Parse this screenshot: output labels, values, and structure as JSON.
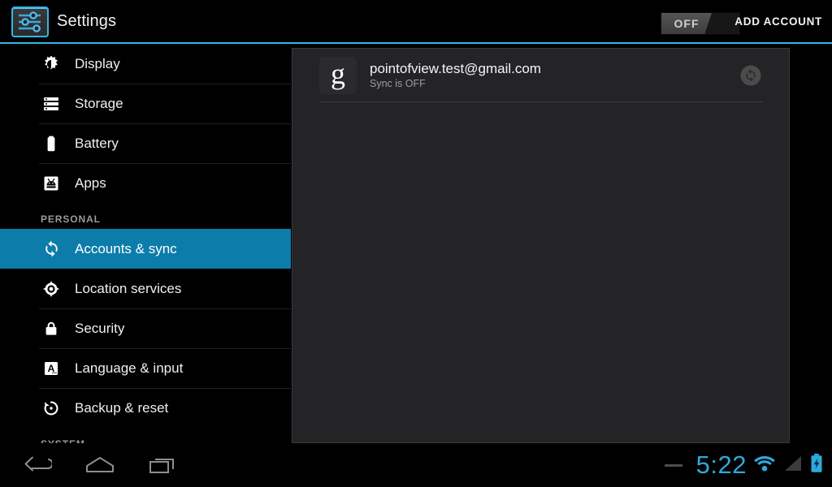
{
  "header": {
    "app_title": "Settings",
    "settings_icon": "settings-sliders-icon",
    "sync_toggle": {
      "label": "OFF",
      "state": "off"
    },
    "add_account_label": "ADD ACCOUNT",
    "accent_color": "#33b5e5"
  },
  "sidebar": {
    "items": [
      {
        "label": "Display",
        "icon": "brightness-icon",
        "selected": false
      },
      {
        "label": "Storage",
        "icon": "storage-icon",
        "selected": false
      },
      {
        "label": "Battery",
        "icon": "battery-icon",
        "selected": false
      },
      {
        "label": "Apps",
        "icon": "apps-android-icon",
        "selected": false
      }
    ],
    "section_personal": "PERSONAL",
    "personal_items": [
      {
        "label": "Accounts & sync",
        "icon": "sync-icon",
        "selected": true
      },
      {
        "label": "Location services",
        "icon": "location-target-icon",
        "selected": false
      },
      {
        "label": "Security",
        "icon": "lock-icon",
        "selected": false
      },
      {
        "label": "Language & input",
        "icon": "language-a-icon",
        "selected": false
      },
      {
        "label": "Backup & reset",
        "icon": "backup-restore-icon",
        "selected": false
      }
    ],
    "section_system": "SYSTEM",
    "selected_color": "#0c7cab"
  },
  "content": {
    "accounts": [
      {
        "provider_glyph": "g",
        "provider_icon": "google-g-icon",
        "email": "pointofview.test@gmail.com",
        "status": "Sync is OFF",
        "sync_badge_icon": "sync-circle-icon"
      }
    ]
  },
  "navbar": {
    "back": "back-icon",
    "home": "home-icon",
    "recents": "recents-icon"
  },
  "statusbar": {
    "notification_dash": "collapsed-notifications-icon",
    "clock": "5:22",
    "wifi_icon": "wifi-icon",
    "signal_icon": "cell-signal-icon",
    "battery_icon": "battery-charging-icon",
    "clock_color": "#2fa8dd"
  }
}
